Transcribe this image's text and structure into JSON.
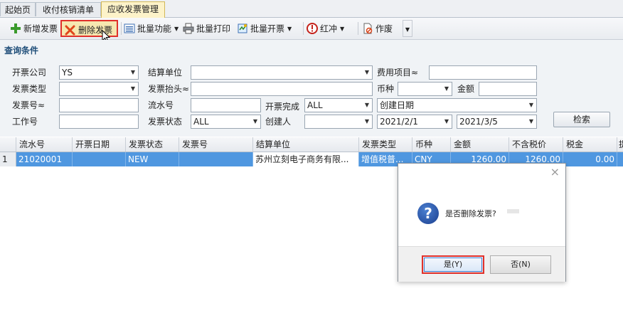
{
  "tabs": [
    {
      "label": "起始页"
    },
    {
      "label": "收付核销清单"
    },
    {
      "label": "应收发票管理"
    }
  ],
  "toolbar": {
    "add": "新增发票",
    "delete": "删除发票",
    "batch_func": "批量功能",
    "batch_print": "批量打印",
    "batch_issue": "批量开票",
    "red": "红冲",
    "void": "作废"
  },
  "query": {
    "title": "查询条件",
    "labels": {
      "company": "开票公司",
      "settle_unit": "结算单位",
      "fee_item": "费用项目≈",
      "invoice_type": "发票类型",
      "invoice_title": "发票抬头≈",
      "currency": "币种",
      "amount": "金额",
      "invoice_no": "发票号≈",
      "serial_no": "流水号",
      "issue_done": "开票完成",
      "work_no": "工作号",
      "invoice_status": "发票状态",
      "creator": "创建人"
    },
    "values": {
      "company": "YS",
      "issue_done": "ALL",
      "date_type": "创建日期",
      "invoice_status": "ALL",
      "date_from": "2021/2/1",
      "date_to": "2021/3/5"
    },
    "search_button": "检索"
  },
  "grid": {
    "columns": [
      "流水号",
      "开票日期",
      "发票状态",
      "发票号",
      "结算单位",
      "发票类型",
      "币种",
      "金额",
      "不含税价",
      "税金",
      "提"
    ],
    "rows": [
      {
        "no": "1",
        "serial": "21020001",
        "date": "",
        "status": "NEW",
        "invoice_no": "",
        "settle": "苏州立刻电子商务有限...",
        "type": "增值税普...",
        "currency": "CNY",
        "amount": "1260.00",
        "net": "1260.00",
        "tax": "0.00"
      }
    ]
  },
  "dialog": {
    "close": "×",
    "message": "是否删除发票?",
    "yes": "是(Y)",
    "no": "否(N)"
  }
}
